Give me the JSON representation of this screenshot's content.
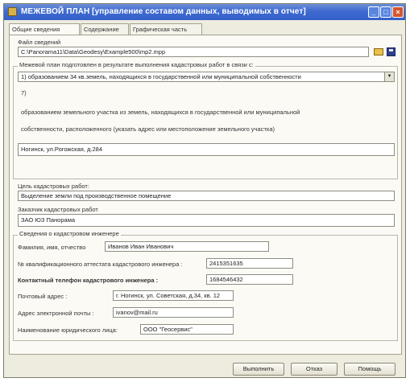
{
  "window": {
    "title": "МЕЖЕВОЙ ПЛАН [управление составом данных, выводимых в отчет]",
    "minimize": "_",
    "maximize": "□",
    "close": "×"
  },
  "tabs": [
    "Общие сведения",
    "Содержание",
    "Графическая часть"
  ],
  "file": {
    "label": "Файл сведений",
    "value": "C:\\Panorama11\\Data\\Geodesy\\Example500\\mp2.mpp"
  },
  "reason": {
    "label": "Межевой план подготовлен в результате выполнения кадастровых работ в  связи с:",
    "selected": "1) образованием 34 кв.земель, находящихся в государственной или муниципальной собственности",
    "number": "7)",
    "desc_line1": "образованием земельного участка из земель, находящихся в государственной или муниципальной",
    "desc_line2": "собственности, расположенного (указать адрес или местоположение земельного участка)",
    "address": "Ногинск, ул.Рогожская, д.284"
  },
  "purpose": {
    "label": "Цель кадастровых работ:",
    "value": "Выделение земли под производственное помещение"
  },
  "customer": {
    "label": "Заказчик кадастровых работ",
    "value": "ЗАО ЮЗ Панорама"
  },
  "engineer": {
    "group_label": "Сведения о кадастровом инженере",
    "fio_label": "Фамилия, имя, отчество",
    "fio": "Иванов Иван Иванович",
    "cert_label": "№ квалификационного аттестата кадастрового инженера :",
    "cert": "2415351635",
    "phone_label": "Контактный телефон кадастрового инженера :",
    "phone": "1684546432",
    "post_label": "Почтовый адрес :",
    "post": "г. Ногинск, ул. Советская, д.34, кв. 12",
    "email_label": "Адрес электронной почты :",
    "email": "ivanov@mail.ru",
    "org_label": "Наименование юридического лица:",
    "org": "ООО \"Геосервис\""
  },
  "buttons": {
    "run": "Выполнить",
    "cancel": "Отказ",
    "help": "Помощь"
  },
  "colors": {
    "titlebar": "#3f6ad0",
    "window_bg": "#eeecdf",
    "close": "#d9542c"
  }
}
